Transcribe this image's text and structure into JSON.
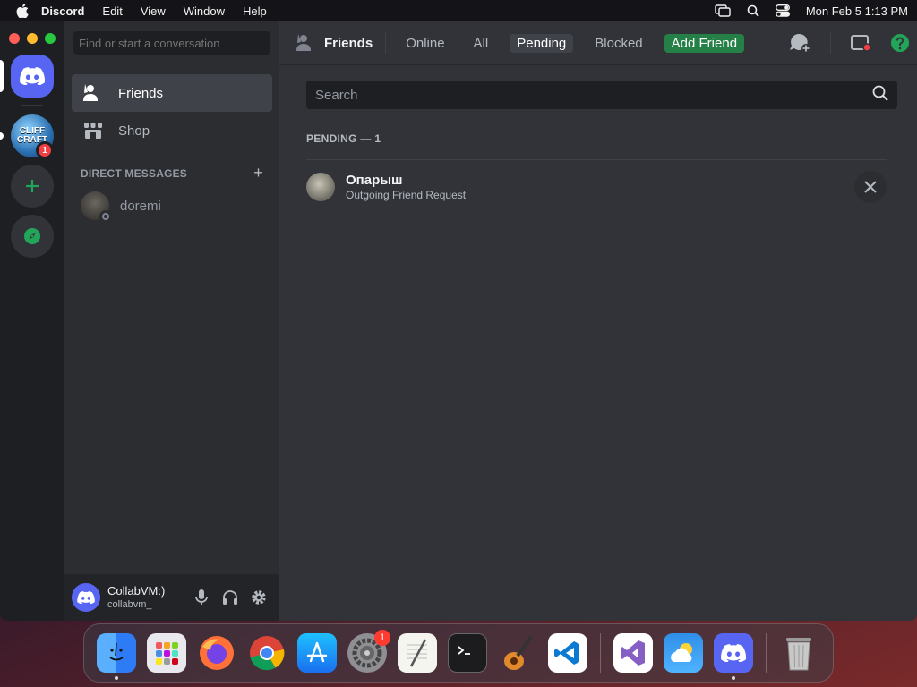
{
  "menubar": {
    "app_name": "Discord",
    "items": [
      "Edit",
      "View",
      "Window",
      "Help"
    ],
    "clock": "Mon Feb 5  1:13 PM"
  },
  "rail": {
    "server_badge": "1",
    "server_label": "CLIFF CRAFT"
  },
  "sidebar": {
    "search_placeholder": "Find or start a conversation",
    "items": [
      {
        "label": "Friends",
        "icon": "friends-icon",
        "active": true
      },
      {
        "label": "Shop",
        "icon": "shop-icon",
        "active": false
      }
    ],
    "dm_header": "DIRECT MESSAGES",
    "dm_add": "+",
    "dms": [
      {
        "name": "doremi",
        "status": "offline"
      }
    ]
  },
  "user": {
    "display_name": "CollabVM:)",
    "username": "collabvm_"
  },
  "topbar": {
    "title": "Friends",
    "tabs": [
      {
        "label": "Online",
        "active": false
      },
      {
        "label": "All",
        "active": false
      },
      {
        "label": "Pending",
        "active": true
      },
      {
        "label": "Blocked",
        "active": false
      }
    ],
    "add_friend": "Add Friend"
  },
  "main": {
    "search_placeholder": "Search",
    "section_label": "PENDING — 1",
    "requests": [
      {
        "name": "Опарыш",
        "subtitle": "Outgoing Friend Request"
      }
    ]
  },
  "dock": {
    "apps": [
      "Finder",
      "Launchpad",
      "Firefox",
      "Chrome",
      "App Store",
      "System Settings",
      "TextEdit",
      "Terminal",
      "GarageBand",
      "VS Code",
      "Visual Studio",
      "Weather",
      "Discord",
      "Trash"
    ],
    "settings_badge": "1"
  },
  "colors": {
    "blurple": "#5865f2",
    "green": "#248046",
    "red": "#f23f43"
  }
}
